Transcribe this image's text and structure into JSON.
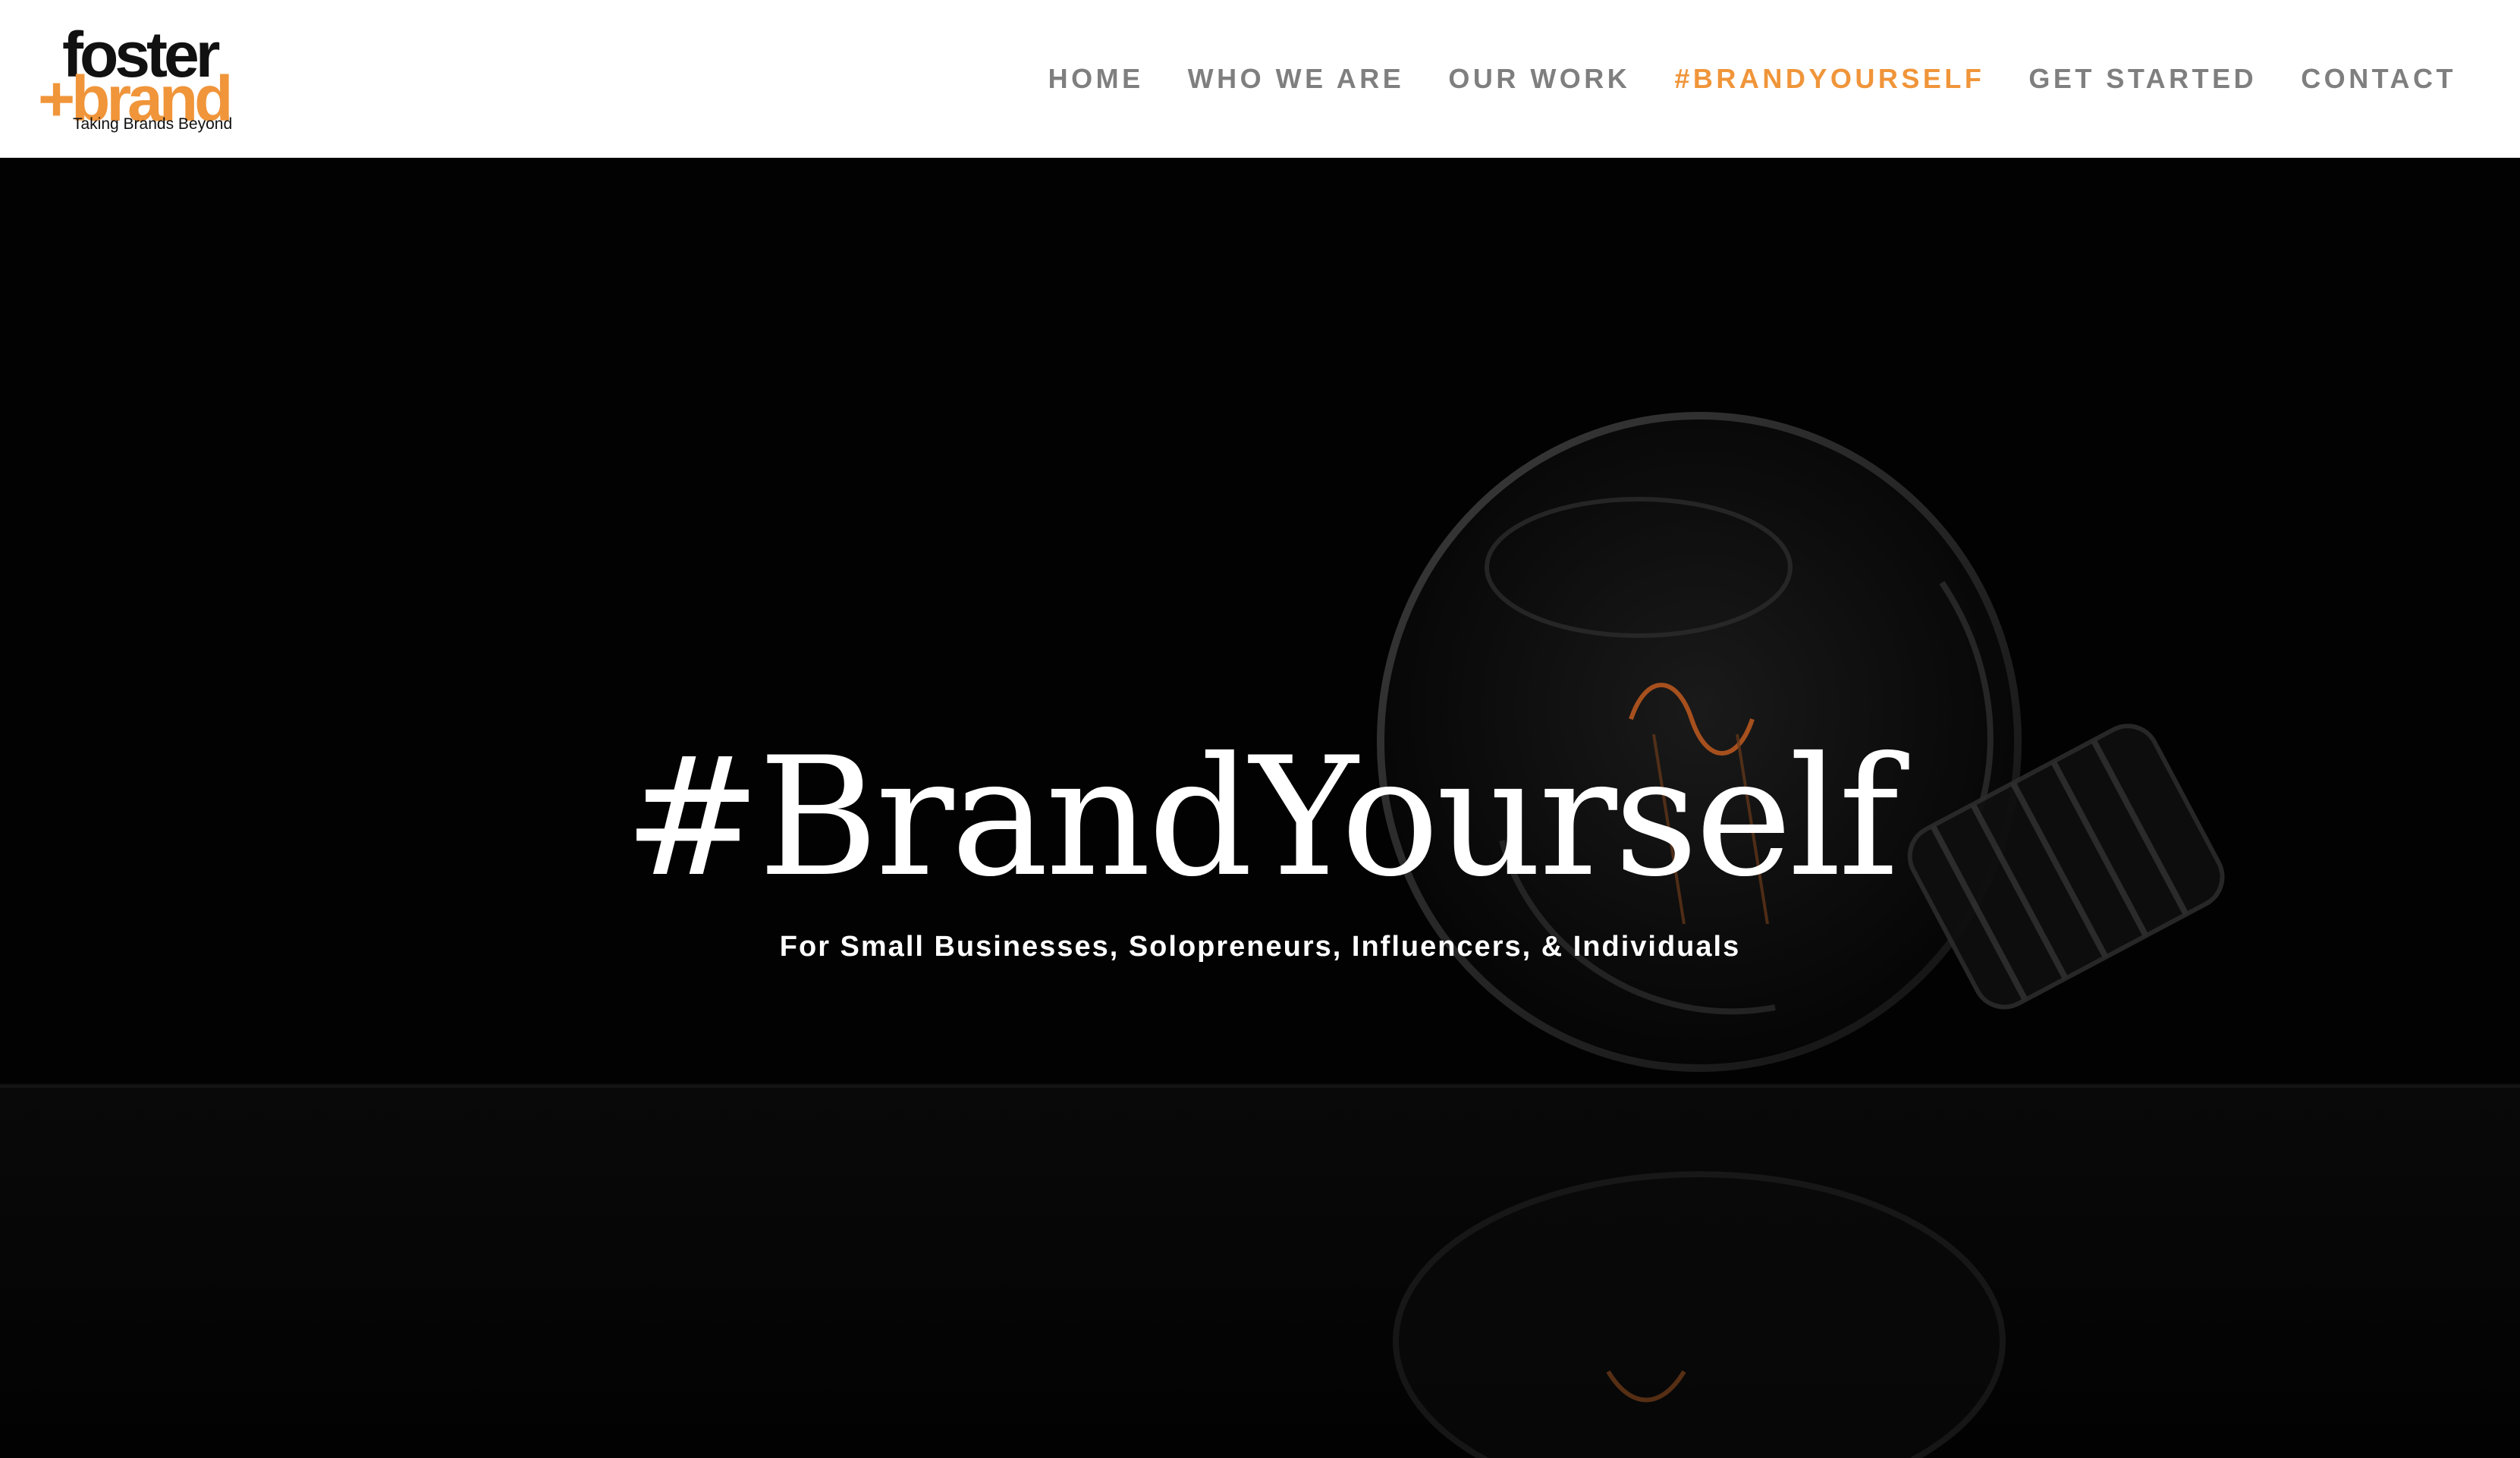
{
  "logo": {
    "line1": "foster",
    "line2": "+brand",
    "tagline": "Taking Brands Beyond"
  },
  "nav": {
    "items": [
      {
        "label": "HOME",
        "active": false
      },
      {
        "label": "WHO WE ARE",
        "active": false
      },
      {
        "label": "OUR WORK",
        "active": false
      },
      {
        "label": "#BRANDYOURSELF",
        "active": true
      },
      {
        "label": "GET STARTED",
        "active": false
      },
      {
        "label": "CONTACT",
        "active": false
      }
    ]
  },
  "hero": {
    "title": "#BrandYourself",
    "subtitle": "For Small Businesses, Solopreneurs, Influencers, & Individuals",
    "background_icon": "light-bulb-icon"
  },
  "colors": {
    "accent": "#f0953a",
    "nav_text": "#7f7f7f",
    "hero_background": "#020202",
    "hero_text": "#ffffff"
  }
}
